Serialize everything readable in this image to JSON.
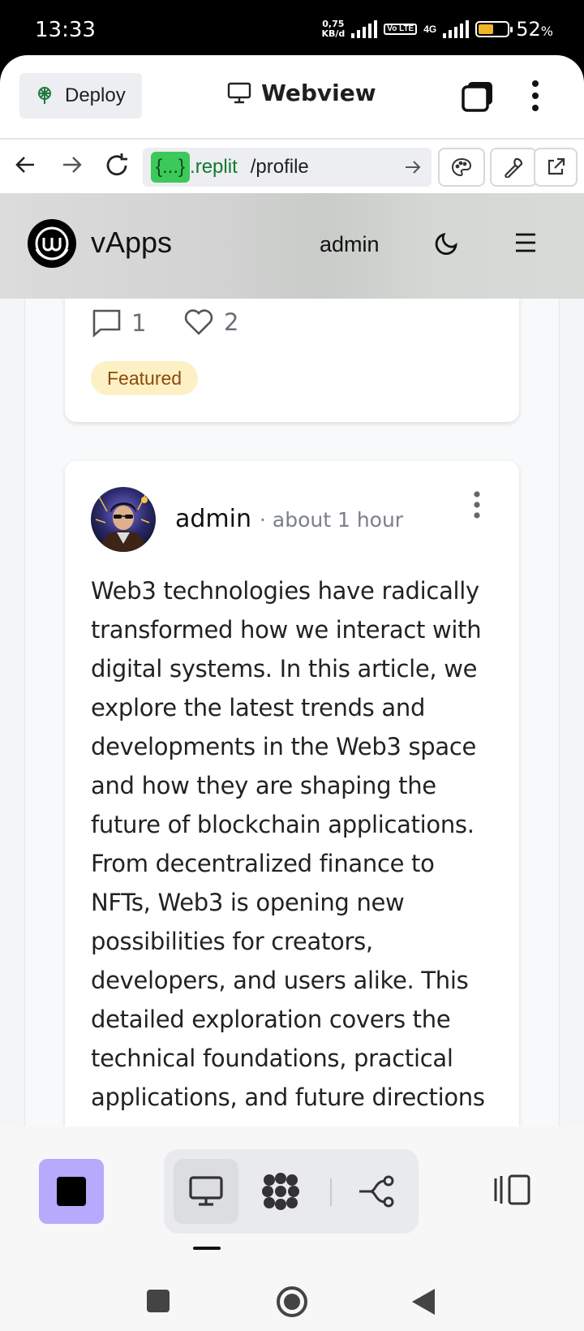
{
  "status_bar": {
    "time": "13:33",
    "speed_value": "0,75",
    "speed_unit": "KB/d",
    "volte": "Vo LTE",
    "network": "4G",
    "battery": "52",
    "battery_suffix": "%",
    "battery_level": 0.52
  },
  "replit_header": {
    "deploy_label": "Deploy",
    "title": "Webview"
  },
  "address_bar": {
    "url_chip": "{...}",
    "host": ".replit",
    "path": "/profile"
  },
  "app": {
    "brand": "vApps",
    "user": "admin"
  },
  "previous_post": {
    "comments": "1",
    "likes": "2",
    "badge": "Featured"
  },
  "post": {
    "author": "admin",
    "time": "· about 1 hour",
    "body": "Web3 technologies have radically transformed how we interact with digital systems. In this article, we explore the latest trends and developments in the Web3 space and how they are shaping the future of blockchain applications. From decentralized finance to NFTs, Web3 is opening new possibilities for creators, developers, and users alike. This detailed exploration covers the technical foundations, practical applications, and future directions"
  },
  "colors": {
    "stop_button": "#b7a9fb",
    "badge_bg": "#fdf0c4",
    "badge_text": "#8a4a0a",
    "url_chip": "#3dc85a"
  }
}
